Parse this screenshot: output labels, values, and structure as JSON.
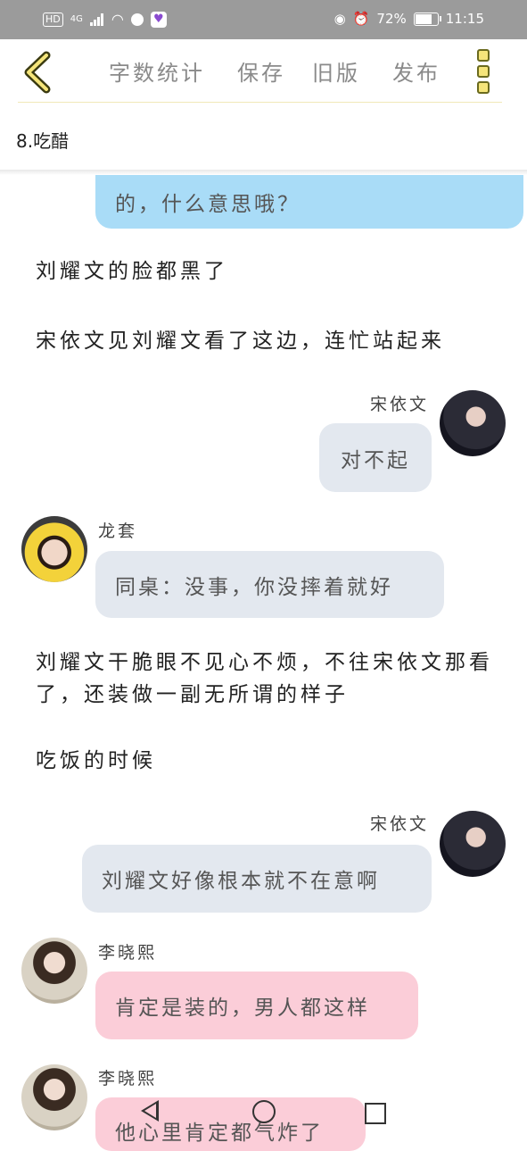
{
  "status": {
    "hd": "HD",
    "network": "4G",
    "battery_text": "72%",
    "battery_level": 0.72,
    "time": "11:15"
  },
  "toolbar": {
    "word_count": "字数统计",
    "save": "保存",
    "old_version": "旧版",
    "publish": "发布"
  },
  "chapter_title": "8.吃醋",
  "messages": {
    "m0_text": "的，什么意思哦？",
    "n1": "刘耀文的脸都黑了",
    "n2": "宋依文见刘耀文看了这边，连忙站起来",
    "m1_name": "宋依文",
    "m1_text": "对不起",
    "m2_name": "龙套",
    "m2_text": "同桌：没事，你没摔着就好",
    "n3": "刘耀文干脆眼不见心不烦，不往宋依文那看了，还装做一副无所谓的样子",
    "n4": "吃饭的时候",
    "m3_name": "宋依文",
    "m3_text": "刘耀文好像根本就不在意啊",
    "m4_name": "李晓熙",
    "m4_text": "肯定是装的，男人都这样",
    "m5_name": "李晓熙",
    "m5_text": "他心里肯定都气炸了"
  },
  "colors": {
    "status_bar": "#9b9b9b",
    "bubble_blue": "#a9dcf7",
    "bubble_gray": "#e3e8ef",
    "bubble_pink": "#fbcdd8",
    "menu_yellow": "#f5e57a"
  }
}
